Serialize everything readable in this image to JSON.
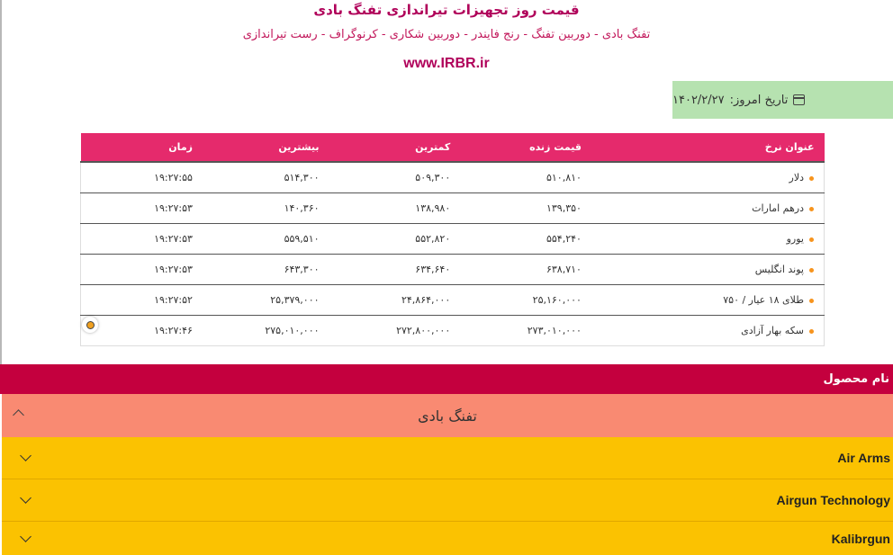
{
  "header": {
    "title": "قیمت روز تجهیزات تیراندازی تفنگ بادی",
    "subtitle": "تفنگ بادی - دوربین تفنگ - رنج فایندر - دوربین شکاری - کرنوگراف - رست تیراندازی",
    "url": "www.IRBR.ir"
  },
  "date": {
    "label": "تاریخ امروز:",
    "value": "۱۴۰۲/۲/۲۷",
    "icon": "calendar-icon"
  },
  "rates_table": {
    "columns": [
      "عنوان نرخ",
      "قیمت زنده",
      "کمترین",
      "بیشترین",
      "زمان"
    ],
    "rows": [
      [
        "دلار",
        "۵۱۰,۸۱۰",
        "۵۰۹,۳۰۰",
        "۵۱۴,۳۰۰",
        "۱۹:۲۷:۵۵"
      ],
      [
        "درهم امارات",
        "۱۳۹,۳۵۰",
        "۱۳۸,۹۸۰",
        "۱۴۰,۳۶۰",
        "۱۹:۲۷:۵۳"
      ],
      [
        "یورو",
        "۵۵۴,۲۴۰",
        "۵۵۲,۸۲۰",
        "۵۵۹,۵۱۰",
        "۱۹:۲۷:۵۳"
      ],
      [
        "پوند انگلیس",
        "۶۳۸,۷۱۰",
        "۶۳۴,۶۴۰",
        "۶۴۳,۳۰۰",
        "۱۹:۲۷:۵۳"
      ],
      [
        "طلای ۱۸ عیار / ۷۵۰",
        "۲۵,۱۶۰,۰۰۰",
        "۲۴,۸۶۴,۰۰۰",
        "۲۵,۳۷۹,۰۰۰",
        "۱۹:۲۷:۵۲"
      ],
      [
        "سکه بهار آزادی",
        "۲۷۳,۰۱۰,۰۰۰",
        "۲۷۲,۸۰۰,۰۰۰",
        "۲۷۵,۰۱۰,۰۰۰",
        "۱۹:۲۷:۴۶"
      ]
    ]
  },
  "products": {
    "header": "نام محصول",
    "category": "تفنگ بادی",
    "brands": [
      "Air Arms",
      "Airgun Technology",
      "Kalibrgun"
    ]
  },
  "colors": {
    "table_header": "#e52a6c",
    "product_header": "#c4003e",
    "category_bg": "#f98a72",
    "brand_bg": "#fbc201",
    "date_bg": "#b6e2b0",
    "bullet": "#f7941d"
  }
}
